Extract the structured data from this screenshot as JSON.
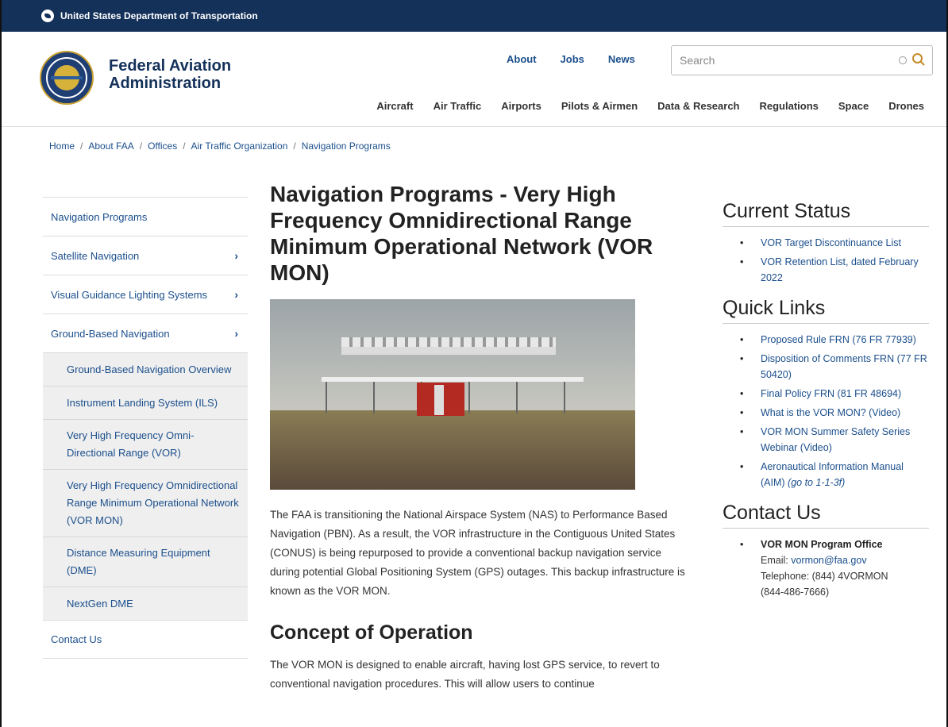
{
  "gov_bar": {
    "text": "United States Department of Transportation"
  },
  "brand": {
    "line1": "Federal Aviation",
    "line2": "Administration"
  },
  "top_links": [
    "About",
    "Jobs",
    "News"
  ],
  "search": {
    "placeholder": "Search"
  },
  "main_nav": [
    "Aircraft",
    "Air Traffic",
    "Airports",
    "Pilots & Airmen",
    "Data & Research",
    "Regulations",
    "Space",
    "Drones"
  ],
  "breadcrumb": [
    "Home",
    "About FAA",
    "Offices",
    "Air Traffic Organization",
    "Navigation Programs"
  ],
  "sidenav": {
    "top": [
      "Navigation Programs",
      "Satellite Navigation",
      "Visual Guidance Lighting Systems",
      "Ground-Based Navigation"
    ],
    "sub": [
      "Ground-Based Navigation Overview",
      "Instrument Landing System (ILS)",
      "Very High Frequency Omni-Directional Range (VOR)",
      "Very High Frequency Omnidirectional Range Minimum Operational Network (VOR MON)",
      "Distance Measuring Equipment (DME)",
      "NextGen DME"
    ],
    "bottom": "Contact Us"
  },
  "content": {
    "title": "Navigation Programs - Very High Frequency Omnidirectional Range Minimum Operational Network (VOR MON)",
    "para1": "The FAA is transitioning the National Airspace System (NAS) to Performance Based Navigation (PBN). As a result, the VOR infrastructure in the Contiguous United States (CONUS) is being repurposed to provide a conventional backup navigation service during potential Global Positioning System (GPS) outages. This backup infrastructure is known as the VOR MON.",
    "h2": "Concept of Operation",
    "para2": "The VOR MON is designed to enable aircraft, having lost GPS service, to revert to conventional navigation procedures. This will allow users to continue"
  },
  "rail": {
    "status_title": "Current Status",
    "status_items": [
      "VOR Target Discontinuance List",
      "VOR Retention List, dated February 2022"
    ],
    "quick_title": "Quick Links",
    "quick_items": [
      "Proposed Rule FRN (76 FR 77939)",
      "Disposition of Comments FRN (77 FR 50420)",
      "Final Policy FRN (81 FR 48694)",
      "What is the VOR MON? (Video)",
      "VOR MON Summer Safety Series Webinar (Video)",
      "Aeronautical Information Manual (AIM)"
    ],
    "quick_note": "(go to 1-1-3f)",
    "contact_title": "Contact Us",
    "contact_name": "VOR MON Program Office",
    "contact_email_label": "Email: ",
    "contact_email": "vormon@faa.gov",
    "contact_phone": "Telephone: (844) 4VORMON",
    "contact_phone2": "(844-486-7666)"
  }
}
